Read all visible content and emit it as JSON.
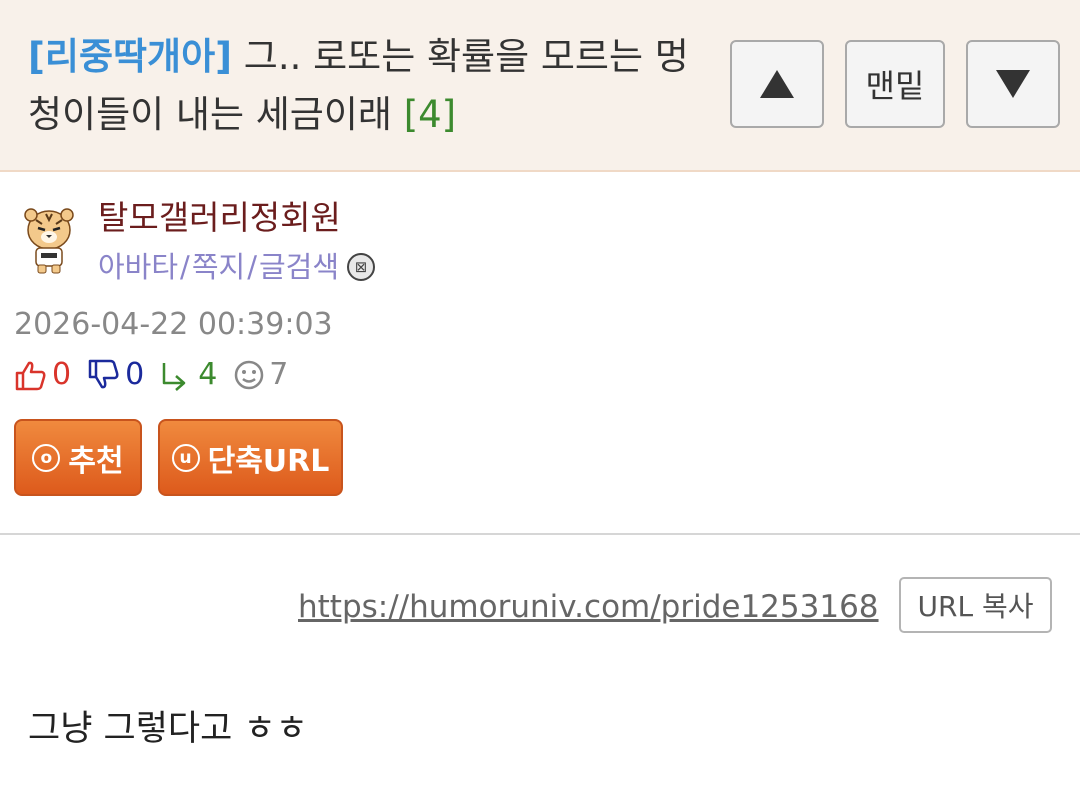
{
  "header": {
    "category": "[리중딱개아]",
    "title": "그.. 로또는 확률을 모르는 멍청이들이 내는 세금이래",
    "comment_count": "[4]",
    "nav_top_label": "맨밑"
  },
  "author": {
    "name": "탈모갤러리정회원",
    "links": [
      "아바타",
      "쪽지",
      "글검색"
    ],
    "separator": "/"
  },
  "post": {
    "date": "2026-04-22 00:39:03",
    "stats": {
      "likes": "0",
      "dislikes": "0",
      "replies": "4",
      "views": "7"
    },
    "buttons": {
      "recommend_icon": "o",
      "recommend_label": "추천",
      "shorturl_icon": "u",
      "shorturl_label": "단축URL"
    },
    "url": "https://humoruniv.com/pride1253168",
    "copy_url_label": "URL 복사",
    "body": "그냥 그렇다고 ㅎㅎ"
  },
  "colors": {
    "header_bg": "#f8f1ea",
    "category": "#3a8fd6",
    "comment_count": "#3c8a2e",
    "author_name": "#6b1d1d",
    "author_links": "#8a84c9",
    "action_button": "#e4692a"
  }
}
